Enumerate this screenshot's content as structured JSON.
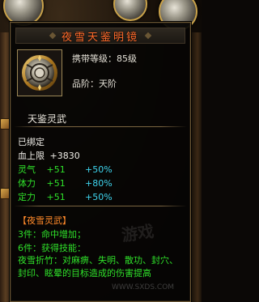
{
  "item": {
    "name": "夜雪天鉴明镜",
    "level_label": "携带等级：85级",
    "grade_label": "品阶：天阶",
    "sub_name": "天鉴灵武",
    "icon": "mirror-medallion-icon"
  },
  "status": {
    "bound": "已绑定",
    "hp_label": "血上限",
    "hp_value": "+3830"
  },
  "stats": [
    {
      "name": "灵气",
      "value": "+51",
      "percent": "+50%"
    },
    {
      "name": "体力",
      "value": "+51",
      "percent": "+80%"
    },
    {
      "name": "定力",
      "value": "+51",
      "percent": "+50%"
    }
  ],
  "set": {
    "title": "【夜雪灵武】",
    "bonus3": "3件：命中增加；",
    "bonus6": "6件：获得技能：",
    "skill": "夜雪折竹：对麻痹、失明、散功、封穴、封印、眩晕的目标造成的伤害提高"
  },
  "watermark": {
    "logo": "游戏",
    "url": "WWW.SXDS.COM"
  },
  "colors": {
    "title": "#ff6a2a",
    "green": "#2fe02a",
    "cyan": "#3fd6f0",
    "set_title": "#ff8a2a",
    "border": "#6a5634"
  }
}
